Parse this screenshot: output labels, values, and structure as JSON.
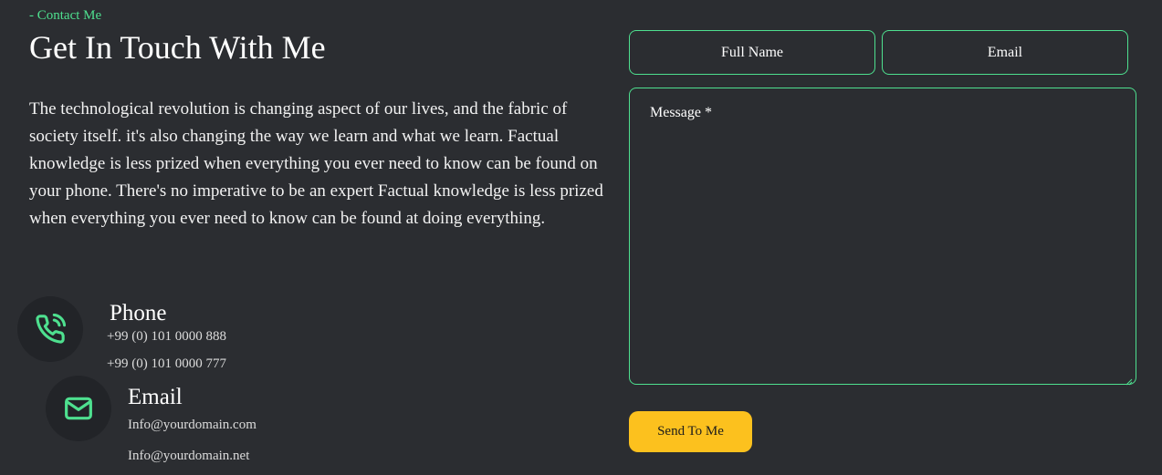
{
  "section": {
    "eyebrow": "- Contact Me",
    "title": "Get In Touch With Me",
    "description": "The technological revolution is changing aspect of our lives, and the fabric of society itself. it's also changing the way we learn and what we learn. Factual knowledge is less prized when everything you ever need to know can be found on your phone. There's no imperative to be an expert Factual knowledge is less prized when everything you ever need to know can be found at doing everything."
  },
  "contacts": {
    "phone": {
      "icon": "phone-call-icon",
      "title": "Phone",
      "lines": [
        "+99 (0) 101 0000 888",
        "+99 (0) 101 0000 777"
      ]
    },
    "email": {
      "icon": "envelope-icon",
      "title": "Email",
      "lines": [
        "Info@yourdomain.com",
        "Info@yourdomain.net"
      ]
    }
  },
  "form": {
    "full_name_placeholder": "Full Name",
    "email_placeholder": "Email",
    "message_placeholder": "Message *",
    "submit_label": "Send To Me"
  },
  "colors": {
    "background": "#2b2d31",
    "accent": "#4ee08f",
    "button": "#fcc11e",
    "icon_circle": "#222428"
  }
}
